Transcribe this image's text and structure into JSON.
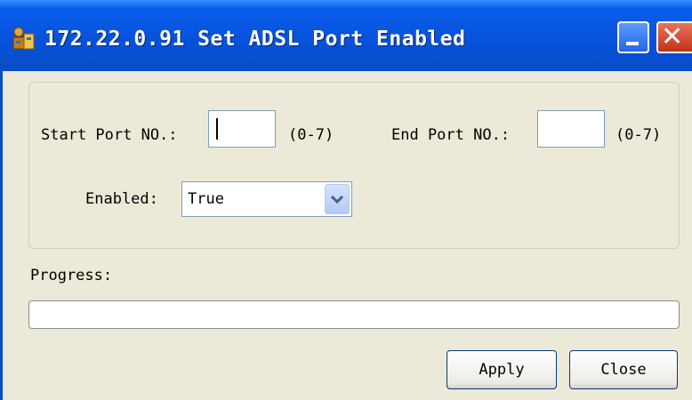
{
  "window": {
    "title": "172.22.0.91 Set ADSL Port Enabled",
    "app_icon": "network-device-icon",
    "controls": [
      "minimize-icon",
      "close-icon"
    ],
    "close_glyph": "✕"
  },
  "form": {
    "start_port_label": "Start Port NO.:",
    "start_port_value": "",
    "start_port_range": "(0-7)",
    "end_port_label": "End Port NO.:",
    "end_port_value": "",
    "end_port_range": "(0-7)",
    "enabled_label": "Enabled:",
    "enabled_value": "True"
  },
  "progress": {
    "label": "Progress:",
    "value": 0
  },
  "buttons": {
    "apply": "Apply",
    "close": "Close"
  },
  "colors": {
    "titlebar": "#0a5fe8",
    "face": "#ece9d8",
    "close_button": "#c1321a"
  }
}
